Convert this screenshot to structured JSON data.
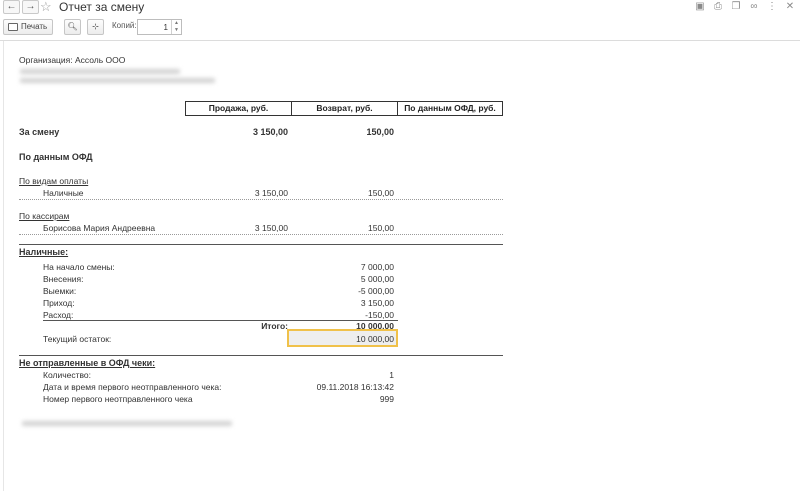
{
  "window": {
    "title": "Отчет за смену",
    "back_icon": "arrow-left-icon",
    "forward_icon": "arrow-right-icon",
    "favorite_icon": "star-icon",
    "right_icons": [
      "save-icon",
      "print-icon",
      "copy-icon",
      "link-icon",
      "more-icon",
      "close-icon"
    ]
  },
  "toolbar": {
    "print_label": "Печать",
    "copies_label": "Копий:",
    "copies_value": "1"
  },
  "report": {
    "organization": "Организация: Ассоль ООО",
    "columns": [
      "Продажа, руб.",
      "Возврат, руб.",
      "По данным ОФД, руб."
    ],
    "shift": {
      "label": "За смену",
      "sales": "3 150,00",
      "returns": "150,00"
    },
    "ofd_heading": "По данным ОФД",
    "by_payment": {
      "heading": "По видам оплаты",
      "rows": [
        {
          "label": "Наличные",
          "sales": "3 150,00",
          "returns": "150,00"
        }
      ]
    },
    "by_cashier": {
      "heading": "По кассирам",
      "rows": [
        {
          "label": "Борисова Мария Андреевна",
          "sales": "3 150,00",
          "returns": "150,00"
        }
      ]
    },
    "cash": {
      "heading": "Наличные:",
      "rows": [
        {
          "label": "На начало смены:",
          "value": "7 000,00"
        },
        {
          "label": "Внесения:",
          "value": "5 000,00"
        },
        {
          "label": "Выемки:",
          "value": "-5 000,00"
        },
        {
          "label": "Приход:",
          "value": "3 150,00"
        },
        {
          "label": "Расход:",
          "value": "-150,00"
        }
      ],
      "total_label": "Итого:",
      "total_value": "10 000,00",
      "balance_label": "Текущий остаток:",
      "balance_value": "10 000,00"
    },
    "unsent": {
      "heading": "Не отправленные в ОФД чеки:",
      "rows": [
        {
          "label": "Количество:",
          "value": "1"
        },
        {
          "label": "Дата и время первого неотправленного чека:",
          "value": "09.11.2018 16:13:42"
        },
        {
          "label": "Номер первого неотправленного чека",
          "value": "999"
        }
      ]
    }
  }
}
